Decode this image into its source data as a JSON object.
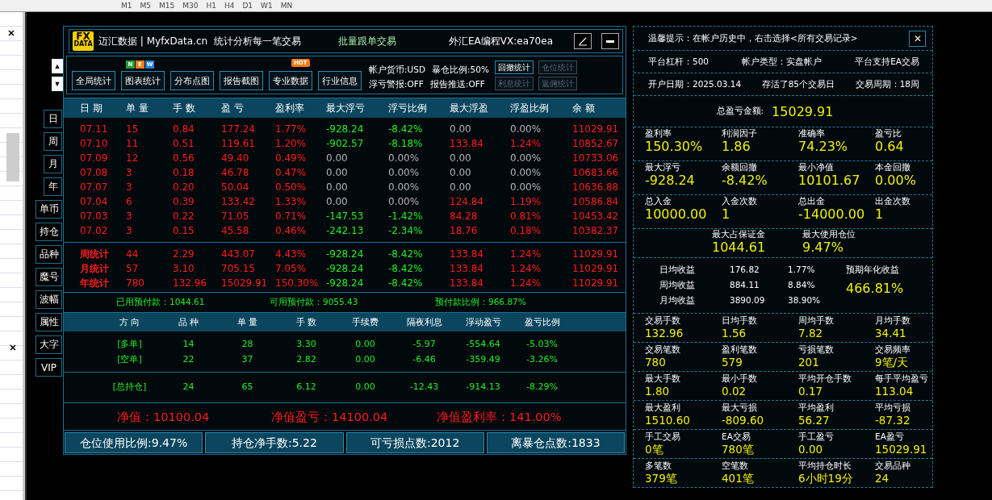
{
  "mt4_toolbar": {
    "timeframes": [
      "M1",
      "M5",
      "M15",
      "M30",
      "H1",
      "H4",
      "D1",
      "W1",
      "MN"
    ]
  },
  "header": {
    "logo_top": "FX",
    "logo_bottom": "DATA",
    "brand": "迈汇数据 | MyfxData.cn",
    "slogan": "统计分析每一笔交易",
    "center": "批量跟单交易",
    "contact": "外汇EA编程VX:ea70ea",
    "scroll_up": "▲",
    "scroll_down": "▼"
  },
  "toolbar": {
    "buttons": [
      {
        "label": "全局统计"
      },
      {
        "label": "图表统计",
        "badge": {
          "kind": "letters",
          "text": [
            "N",
            "E",
            "W"
          ]
        }
      },
      {
        "label": "分布点图"
      },
      {
        "label": "报告截图"
      },
      {
        "label": "专业数据",
        "badge": {
          "kind": "tag",
          "text": [
            "HOT"
          ]
        }
      },
      {
        "label": "行业信息"
      }
    ],
    "info": [
      [
        "帐户货币:USD",
        "暴仓比例:50%"
      ],
      [
        "浮亏警报:OFF",
        "报告推送:OFF"
      ]
    ],
    "small_buttons": [
      {
        "label": "回撤统计",
        "disabled": false
      },
      {
        "label": "仓位统计",
        "disabled": true
      },
      {
        "label": "利息统计",
        "disabled": true
      },
      {
        "label": "返佣统计",
        "disabled": true
      }
    ]
  },
  "side_tabs": [
    {
      "label": "日",
      "kind": "narrow"
    },
    {
      "label": "周",
      "kind": "narrow"
    },
    {
      "label": "月",
      "kind": "narrow"
    },
    {
      "label": "年",
      "kind": "narrow"
    },
    {
      "label": "单币",
      "kind": "wide"
    },
    {
      "label": "持仓",
      "kind": "wide"
    },
    {
      "label": "品种",
      "kind": "wide"
    },
    {
      "label": "魔号",
      "kind": "wide"
    },
    {
      "label": "波幅",
      "kind": "wide"
    },
    {
      "label": "属性",
      "kind": "wide"
    },
    {
      "label": "大字",
      "kind": "wide"
    },
    {
      "label": "VIP",
      "kind": "wide"
    }
  ],
  "daily_table": {
    "columns": [
      "日 期",
      "单 量",
      "手 数",
      "盈 亏",
      "盈利率",
      "最大浮亏",
      "浮亏比例",
      "最大浮盈",
      "浮盈比例",
      "余 额"
    ],
    "rows": [
      {
        "cells": [
          {
            "text": "07.11",
            "color": "#ff1a1a"
          },
          {
            "text": "15",
            "color": "#ff1a1a"
          },
          {
            "text": "0.84",
            "color": "#ff1a1a"
          },
          {
            "text": "177.24",
            "color": "#ff1a1a"
          },
          {
            "text": "1.77%",
            "color": "#ff1a1a"
          },
          {
            "text": "-928.24",
            "color": "#22ee22"
          },
          {
            "text": "-8.42%",
            "color": "#22ee22"
          },
          {
            "text": "0.00",
            "color": "#b4b4b4"
          },
          {
            "text": "0.00%",
            "color": "#b4b4b4"
          },
          {
            "text": "11029.91",
            "color": "#ff1a1a"
          }
        ]
      },
      {
        "cells": [
          {
            "text": "07.10",
            "color": "#ff1a1a"
          },
          {
            "text": "11",
            "color": "#ff1a1a"
          },
          {
            "text": "0.51",
            "color": "#ff1a1a"
          },
          {
            "text": "119.61",
            "color": "#ff1a1a"
          },
          {
            "text": "1.20%",
            "color": "#ff1a1a"
          },
          {
            "text": "-902.57",
            "color": "#22ee22"
          },
          {
            "text": "-8.18%",
            "color": "#22ee22"
          },
          {
            "text": "133.84",
            "color": "#ff1a1a"
          },
          {
            "text": "1.24%",
            "color": "#ff1a1a"
          },
          {
            "text": "10852.67",
            "color": "#ff1a1a"
          }
        ]
      },
      {
        "cells": [
          {
            "text": "07.09",
            "color": "#ff1a1a"
          },
          {
            "text": "12",
            "color": "#ff1a1a"
          },
          {
            "text": "0.56",
            "color": "#ff1a1a"
          },
          {
            "text": "49.40",
            "color": "#ff1a1a"
          },
          {
            "text": "0.49%",
            "color": "#ff1a1a"
          },
          {
            "text": "0.00",
            "color": "#b4b4b4"
          },
          {
            "text": "0.00%",
            "color": "#b4b4b4"
          },
          {
            "text": "0.00",
            "color": "#b4b4b4"
          },
          {
            "text": "0.00%",
            "color": "#b4b4b4"
          },
          {
            "text": "10733.06",
            "color": "#ff1a1a"
          }
        ]
      },
      {
        "cells": [
          {
            "text": "07.08",
            "color": "#ff1a1a"
          },
          {
            "text": "3",
            "color": "#ff1a1a"
          },
          {
            "text": "0.18",
            "color": "#ff1a1a"
          },
          {
            "text": "46.78",
            "color": "#ff1a1a"
          },
          {
            "text": "0.47%",
            "color": "#ff1a1a"
          },
          {
            "text": "0.00",
            "color": "#b4b4b4"
          },
          {
            "text": "0.00%",
            "color": "#b4b4b4"
          },
          {
            "text": "0.00",
            "color": "#b4b4b4"
          },
          {
            "text": "0.00%",
            "color": "#b4b4b4"
          },
          {
            "text": "10683.66",
            "color": "#ff1a1a"
          }
        ]
      },
      {
        "cells": [
          {
            "text": "07.07",
            "color": "#ff1a1a"
          },
          {
            "text": "3",
            "color": "#ff1a1a"
          },
          {
            "text": "0.20",
            "color": "#ff1a1a"
          },
          {
            "text": "50.04",
            "color": "#ff1a1a"
          },
          {
            "text": "0.50%",
            "color": "#ff1a1a"
          },
          {
            "text": "0.00",
            "color": "#b4b4b4"
          },
          {
            "text": "0.00%",
            "color": "#b4b4b4"
          },
          {
            "text": "0.00",
            "color": "#b4b4b4"
          },
          {
            "text": "0.00%",
            "color": "#b4b4b4"
          },
          {
            "text": "10636.88",
            "color": "#ff1a1a"
          }
        ]
      },
      {
        "cells": [
          {
            "text": "07.04",
            "color": "#ff1a1a"
          },
          {
            "text": "6",
            "color": "#ff1a1a"
          },
          {
            "text": "0.39",
            "color": "#ff1a1a"
          },
          {
            "text": "133.42",
            "color": "#ff1a1a"
          },
          {
            "text": "1.33%",
            "color": "#ff1a1a"
          },
          {
            "text": "0.00",
            "color": "#b4b4b4"
          },
          {
            "text": "0.00%",
            "color": "#b4b4b4"
          },
          {
            "text": "124.84",
            "color": "#ff1a1a"
          },
          {
            "text": "1.19%",
            "color": "#ff1a1a"
          },
          {
            "text": "10586.84",
            "color": "#ff1a1a"
          }
        ]
      },
      {
        "cells": [
          {
            "text": "07.03",
            "color": "#ff1a1a"
          },
          {
            "text": "3",
            "color": "#ff1a1a"
          },
          {
            "text": "0.22",
            "color": "#ff1a1a"
          },
          {
            "text": "71.05",
            "color": "#ff1a1a"
          },
          {
            "text": "0.71%",
            "color": "#ff1a1a"
          },
          {
            "text": "-147.53",
            "color": "#22ee22"
          },
          {
            "text": "-1.42%",
            "color": "#22ee22"
          },
          {
            "text": "84.28",
            "color": "#ff1a1a"
          },
          {
            "text": "0.81%",
            "color": "#ff1a1a"
          },
          {
            "text": "10453.42",
            "color": "#ff1a1a"
          }
        ]
      },
      {
        "cells": [
          {
            "text": "07.02",
            "color": "#ff1a1a"
          },
          {
            "text": "3",
            "color": "#ff1a1a"
          },
          {
            "text": "0.15",
            "color": "#ff1a1a"
          },
          {
            "text": "45.58",
            "color": "#ff1a1a"
          },
          {
            "text": "0.46%",
            "color": "#ff1a1a"
          },
          {
            "text": "-242.13",
            "color": "#22ee22"
          },
          {
            "text": "-2.34%",
            "color": "#22ee22"
          },
          {
            "text": "18.76",
            "color": "#ff1a1a"
          },
          {
            "text": "0.18%",
            "color": "#ff1a1a"
          },
          {
            "text": "10382.37",
            "color": "#ff1a1a"
          }
        ]
      }
    ],
    "totals": [
      {
        "cells": [
          {
            "text": "周统计",
            "color": "#ff1a1a"
          },
          {
            "text": "44",
            "color": "#ff1a1a"
          },
          {
            "text": "2.29",
            "color": "#ff1a1a"
          },
          {
            "text": "443.07",
            "color": "#ff1a1a"
          },
          {
            "text": "4.43%",
            "color": "#ff1a1a"
          },
          {
            "text": "-928.24",
            "color": "#22ee22"
          },
          {
            "text": "-8.42%",
            "color": "#22ee22"
          },
          {
            "text": "133.84",
            "color": "#ff1a1a"
          },
          {
            "text": "1.24%",
            "color": "#ff1a1a"
          },
          {
            "text": "11029.91",
            "color": "#ff1a1a"
          }
        ]
      },
      {
        "cells": [
          {
            "text": "月统计",
            "color": "#ff1a1a"
          },
          {
            "text": "57",
            "color": "#ff1a1a"
          },
          {
            "text": "3.10",
            "color": "#ff1a1a"
          },
          {
            "text": "705.15",
            "color": "#ff1a1a"
          },
          {
            "text": "7.05%",
            "color": "#ff1a1a"
          },
          {
            "text": "-928.24",
            "color": "#22ee22"
          },
          {
            "text": "-8.42%",
            "color": "#22ee22"
          },
          {
            "text": "133.84",
            "color": "#ff1a1a"
          },
          {
            "text": "1.24%",
            "color": "#ff1a1a"
          },
          {
            "text": "11029.91",
            "color": "#ff1a1a"
          }
        ]
      },
      {
        "cells": [
          {
            "text": "年统计",
            "color": "#ff1a1a"
          },
          {
            "text": "780",
            "color": "#ff1a1a"
          },
          {
            "text": "132.96",
            "color": "#ff1a1a"
          },
          {
            "text": "15029.91",
            "color": "#ff1a1a"
          },
          {
            "text": "150.30%",
            "color": "#ff1a1a"
          },
          {
            "text": "-928.24",
            "color": "#22ee22"
          },
          {
            "text": "-8.42%",
            "color": "#22ee22"
          },
          {
            "text": "133.84",
            "color": "#ff1a1a"
          },
          {
            "text": "1.24%",
            "color": "#ff1a1a"
          },
          {
            "text": "11029.91",
            "color": "#ff1a1a"
          }
        ]
      }
    ]
  },
  "prepay": [
    "已用预付款：1044.61",
    "可用预付款：9055.43",
    "预付款比例：966.87%"
  ],
  "positions": {
    "columns": [
      "方 向",
      "品 种",
      "单 量",
      "手 数",
      "手续费",
      "隔夜利息",
      "浮动盈亏",
      "盈亏比例"
    ],
    "rows": [
      [
        "[多单]",
        "14",
        "28",
        "3.30",
        "0.00",
        "-5.97",
        "-554.64",
        "-5.03%"
      ],
      [
        "[空单]",
        "22",
        "37",
        "2.82",
        "0.00",
        "-6.46",
        "-359.49",
        "-3.26%"
      ]
    ],
    "total": [
      "[总持仓]",
      "24",
      "65",
      "6.12",
      "0.00",
      "-12.43",
      "-914.13",
      "-8.29%"
    ]
  },
  "equity": [
    "净值：10100.04",
    "净值盈亏：14100.04",
    "净值盈利率：141.00%"
  ],
  "status_bar": [
    "仓位使用比例:9.47%",
    "持仓净手数:5.22",
    "可亏损点数:2012",
    "离暴仓点数:1833"
  ],
  "side_panel": {
    "tip": "温馨提示：在帐户历史中，右击选择<所有交易记录>",
    "close": "✕",
    "info_rows": [
      [
        "平台杠杆：500",
        "帐户类型：实盘帐户",
        "平台支持EA交易"
      ],
      [
        "开户日期：2025.03.14",
        "存活了85个交易日",
        "交易周期：18周"
      ]
    ],
    "total_label": "总盈亏金额:",
    "total_value": "15029.91",
    "groups_top": [
      {
        "kind": "large",
        "items": [
          {
            "label": "盈利率",
            "value": "150.30%"
          },
          {
            "label": "利润因子",
            "value": "1.86"
          },
          {
            "label": "准确率",
            "value": "74.23%"
          },
          {
            "label": "盈亏比",
            "value": "0.64"
          }
        ]
      },
      {
        "kind": "large",
        "items": [
          {
            "label": "最大浮亏",
            "value": "-928.24"
          },
          {
            "label": "余额回撤",
            "value": "-8.42%"
          },
          {
            "label": "最小净值",
            "value": "10101.67"
          },
          {
            "label": "本金回撤",
            "value": "0.00%"
          }
        ]
      },
      {
        "kind": "large",
        "items": [
          {
            "label": "总入金",
            "value": "10000.00"
          },
          {
            "label": "入金次数",
            "value": "1"
          },
          {
            "label": "总出金",
            "value": "-14000.00"
          },
          {
            "label": "出金次数",
            "value": "1"
          }
        ]
      },
      {
        "kind": "centered",
        "items": [
          {
            "label": "最大占保证金",
            "value": "1044.61"
          },
          {
            "label": "最大使用仓位",
            "value": "9.47%"
          }
        ]
      }
    ],
    "averages": [
      {
        "label": "日均收益",
        "amount": "176.82",
        "percent": "1.77%"
      },
      {
        "label": "周均收益",
        "amount": "884.11",
        "percent": "8.84%"
      },
      {
        "label": "月均收益",
        "amount": "3890.09",
        "percent": "38.90%"
      }
    ],
    "annual_label": "预期年化收益",
    "annual_value": "466.81%",
    "groups_bottom": [
      {
        "kind": "small",
        "items": [
          {
            "label": "交易手数",
            "value": "132.96"
          },
          {
            "label": "日均手数",
            "value": "1.56"
          },
          {
            "label": "周均手数",
            "value": "7.82"
          },
          {
            "label": "月均手数",
            "value": "34.41"
          }
        ]
      },
      {
        "kind": "small",
        "items": [
          {
            "label": "交易笔数",
            "value": "780"
          },
          {
            "label": "盈利笔数",
            "value": "579"
          },
          {
            "label": "亏损笔数",
            "value": "201"
          },
          {
            "label": "交易频率",
            "value": "9笔/天"
          }
        ]
      },
      {
        "kind": "small",
        "items": [
          {
            "label": "最大手数",
            "value": "1.80"
          },
          {
            "label": "最小手数",
            "value": "0.02"
          },
          {
            "label": "平均开仓手数",
            "value": "0.17"
          },
          {
            "label": "每手平均盈亏",
            "value": "113.04"
          }
        ]
      },
      {
        "kind": "small",
        "items": [
          {
            "label": "最大盈利",
            "value": "1510.60"
          },
          {
            "label": "最大亏损",
            "value": "-809.60"
          },
          {
            "label": "平均盈利",
            "value": "56.27"
          },
          {
            "label": "平均亏损",
            "value": "-87.32"
          }
        ]
      },
      {
        "kind": "small",
        "items": [
          {
            "label": "手工交易",
            "value": "0笔"
          },
          {
            "label": "EA交易",
            "value": "780笔"
          },
          {
            "label": "手工盈亏",
            "value": "0.00"
          },
          {
            "label": "EA盈亏",
            "value": "15029.91"
          }
        ]
      },
      {
        "kind": "small",
        "items": [
          {
            "label": "多笔数",
            "value": "379笔"
          },
          {
            "label": "空笔数",
            "value": "401笔"
          },
          {
            "label": "平均持仓时长",
            "value": "6小时19分"
          },
          {
            "label": "交易品种",
            "value": "24"
          }
        ]
      }
    ]
  }
}
